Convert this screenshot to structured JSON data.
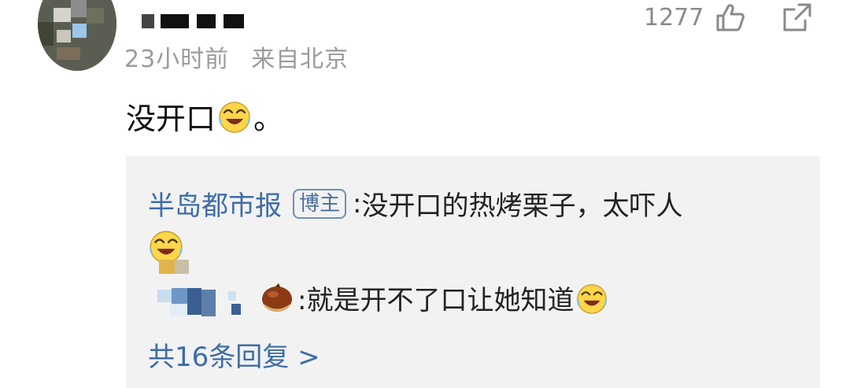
{
  "comment": {
    "time": "23小时前",
    "source": "来自北京",
    "like_count": "1277",
    "text_before": "没开口",
    "text_after": "。",
    "icons": {
      "like": "thumbs-up-icon",
      "share": "share-icon",
      "emoji": "laughing-crying-emoji-icon"
    }
  },
  "reply_preview": {
    "author": "半岛都市报",
    "badge": "博主",
    "sep": ": ",
    "text": "没开口的热烤栗子，太吓人",
    "second_text": ":就是开不了口让她知道",
    "more_link": "共16条回复 >"
  },
  "colors": {
    "link": "#3d6ca8",
    "meta": "#9b9b9b",
    "box_bg": "#f2f2f2"
  }
}
